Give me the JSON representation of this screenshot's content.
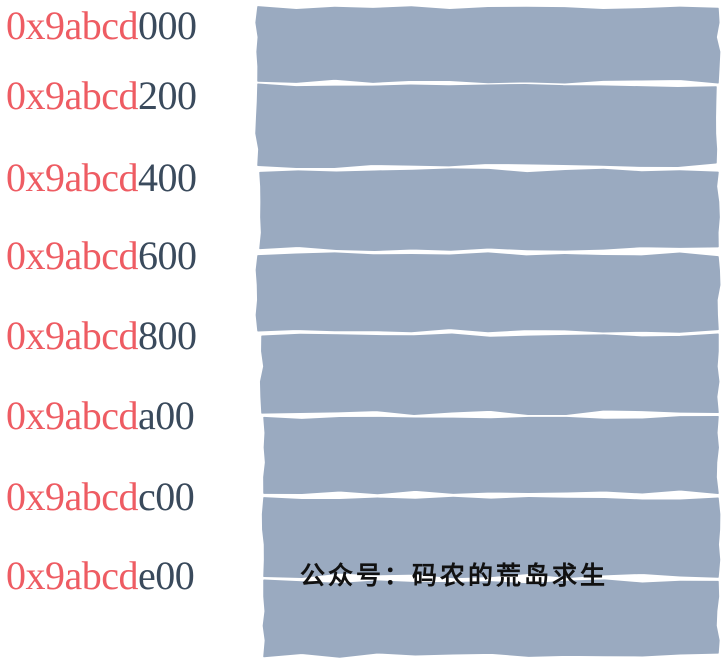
{
  "colors": {
    "address_prefix": "#ee5c63",
    "address_suffix": "#3a4a5c",
    "block_fill": "#9aaac0"
  },
  "memory": {
    "prefix": "0x9abcd",
    "rows": [
      {
        "suffix": "000"
      },
      {
        "suffix": "200"
      },
      {
        "suffix": "400"
      },
      {
        "suffix": "600"
      },
      {
        "suffix": "800"
      },
      {
        "suffix": "a00"
      },
      {
        "suffix": "c00"
      },
      {
        "suffix": "e00"
      }
    ]
  },
  "watermark": "公众号：码农的荒岛求生"
}
